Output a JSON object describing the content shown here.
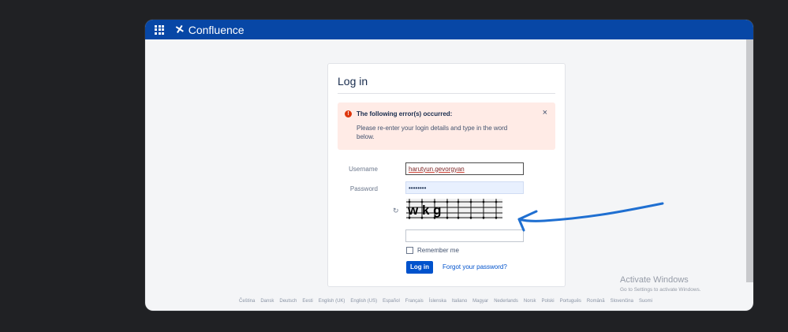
{
  "app": {
    "name": "Confluence"
  },
  "login": {
    "title": "Log in",
    "error": {
      "title": "The following error(s) occurred:",
      "message": "Please re-enter your login details and type in the word below.",
      "close": "×"
    },
    "username_label": "Username",
    "username_value": "harutyun.gevorgyan",
    "password_label": "Password",
    "password_value": "••••••••",
    "captcha_text": "w   k   g",
    "captcha_input": "",
    "remember_label": "Remember me",
    "login_button": "Log in",
    "forgot_link": "Forgot your password?"
  },
  "footer": {
    "languages": [
      "Čeština",
      "Dansk",
      "Deutsch",
      "Eesti",
      "English (UK)",
      "English (US)",
      "Español",
      "Français",
      "Íslenska",
      "Italiano",
      "Magyar",
      "Nederlands",
      "Norsk",
      "Polski",
      "Português",
      "Română",
      "Slovenčina",
      "Suomi"
    ]
  },
  "watermark": {
    "line1": "Activate Windows",
    "line2": "Go to Settings to activate Windows."
  },
  "colors": {
    "topbar": "#0747a6",
    "error_bg": "#ffebe6",
    "primary": "#0052cc",
    "annotation": "#1f6fd1"
  }
}
